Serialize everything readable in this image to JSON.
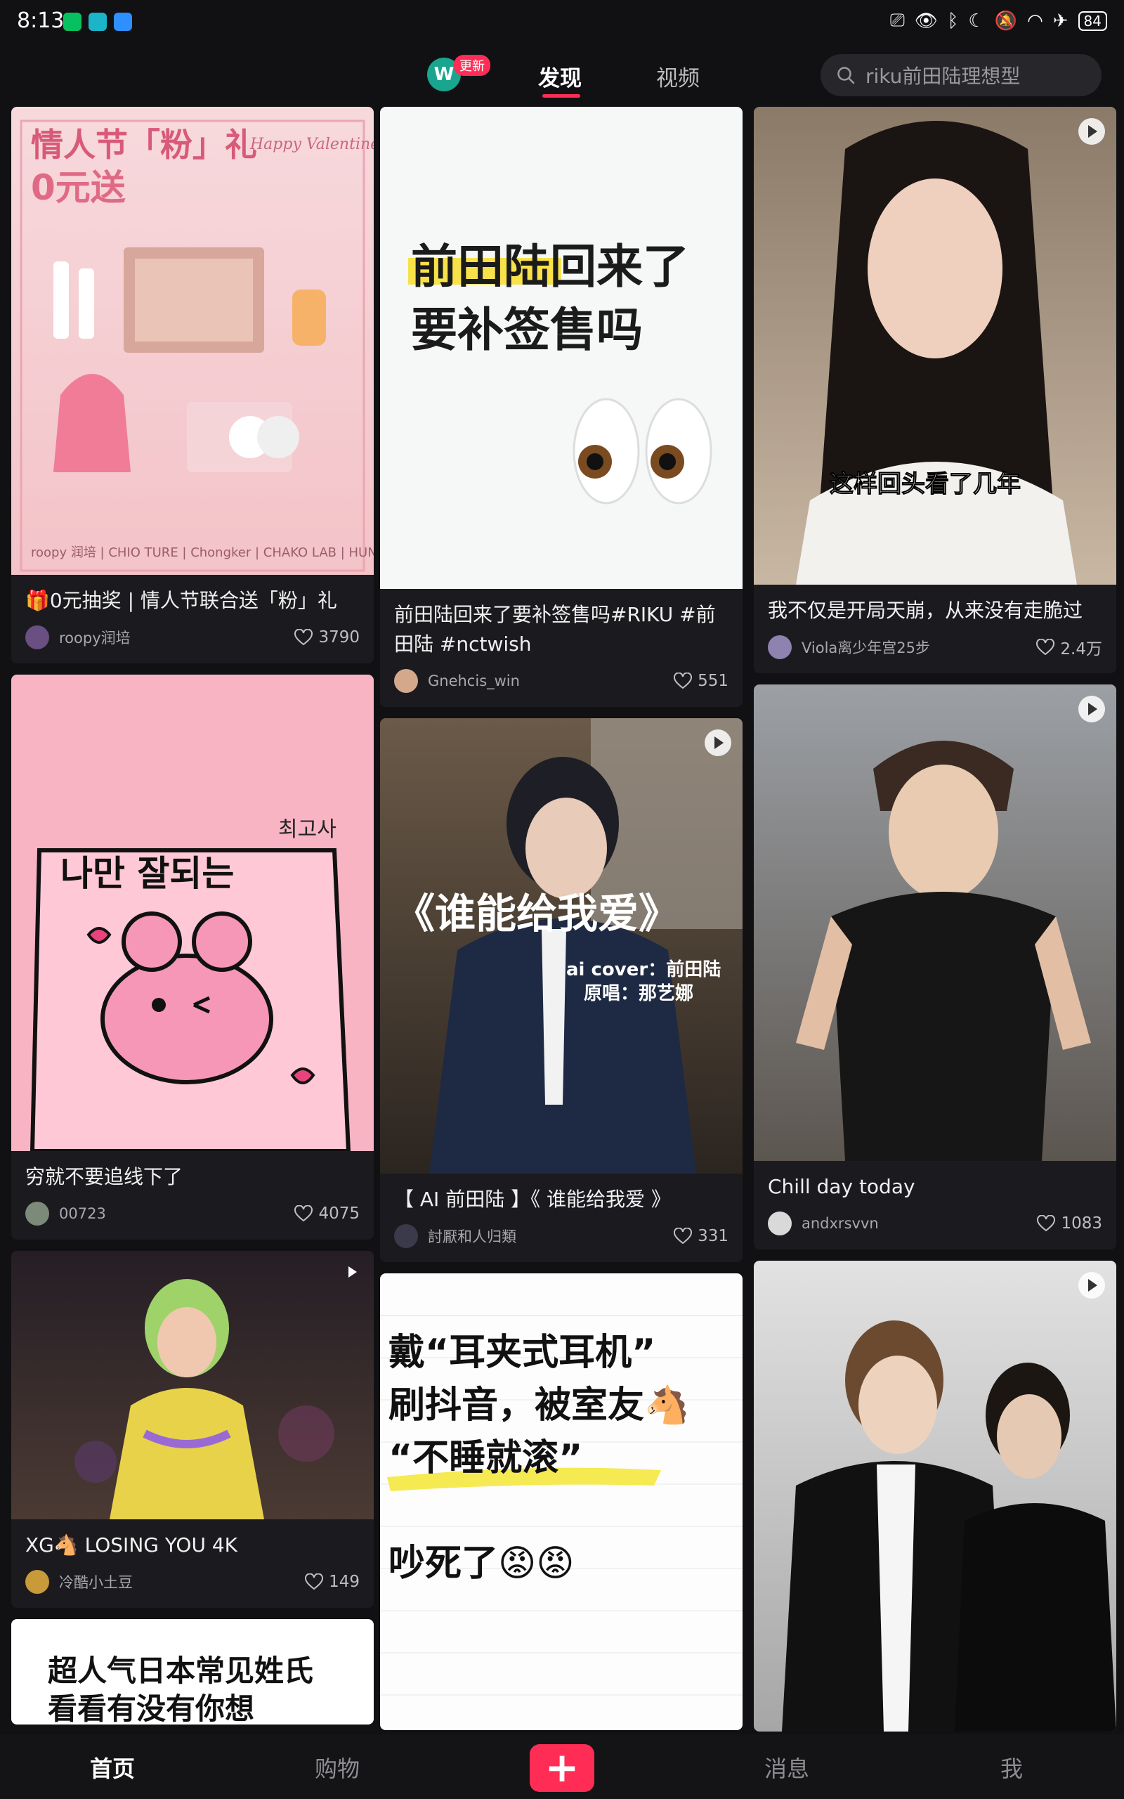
{
  "status_bar": {
    "time": "8:13",
    "battery": "84"
  },
  "top_nav": {
    "logo": "W",
    "update_badge": "更新",
    "tabs": [
      {
        "label": "发现",
        "active": true
      },
      {
        "label": "视频",
        "active": false
      }
    ],
    "search_placeholder": "riku前田陆理想型"
  },
  "covers": {
    "valentine": {
      "headline_1": "情人节「粉」礼",
      "headline_2": "0元送",
      "headline_en": "Happy Valentine's Day",
      "brands": "roopy 润培 | CHIO TURE | Chongker | CHAKO LAB | HUNG CHI"
    },
    "riku": {
      "line_1": "前田陆回来了",
      "line_2": "要补签售吗"
    },
    "woman": {
      "subtitle": "这样回头看了几年"
    },
    "pink": {
      "korean_top": "최고사",
      "korean_main": "나만 잘되는"
    },
    "ai": {
      "title": "《谁能给我爱》",
      "credit_1": "ai cover：前田陆",
      "credit_2": "原唱：那艺娜"
    },
    "ear": {
      "line_1": "戴“耳夹式耳机”",
      "line_2": "刷抖音，被室友🐴",
      "line_3": "“不睡就滚”",
      "line_4": "吵死了😡😡"
    },
    "name": {
      "line_1": "超人气日本常见姓氏",
      "line_2": "看看有没有你想"
    }
  },
  "feed": {
    "col1": [
      {
        "id": "valentine",
        "title": "🎁0元抽奖 | 情人节联合送「粉」礼",
        "author": "roopy润培",
        "likes": "3790",
        "video": false
      },
      {
        "id": "pink",
        "title": "穷就不要追线下了",
        "author": "00723",
        "likes": "4075",
        "video": false
      },
      {
        "id": "xg",
        "title": "XG🐴 LOSING YOU 4K",
        "author": "冷酷小土豆",
        "likes": "149",
        "video": true
      }
    ],
    "col2": [
      {
        "id": "riku",
        "title": "前田陆回来了要补签售吗#RIKU #前田陆 #nctwish",
        "author": "Gnehcis_win",
        "likes": "551",
        "video": false
      },
      {
        "id": "ai",
        "title": "【 AI 前田陆 】《 谁能给我爱 》",
        "author": "討厭和人归類",
        "likes": "331",
        "video": true
      }
    ],
    "col3": [
      {
        "id": "woman",
        "title": "我不仅是开局天崩，从来没有走脆过",
        "author": "Viola离少年宫25步",
        "likes": "2.4万",
        "video": true
      },
      {
        "id": "chill",
        "title": "Chill day today",
        "author": "andxrsvvn",
        "likes": "1083",
        "video": true
      }
    ]
  },
  "bottom_nav": {
    "home": "首页",
    "shop": "购物",
    "add": "+",
    "messages": "消息",
    "me": "我"
  },
  "colors": {
    "accent": "#ff2d55",
    "background": "#111114",
    "card": "#1b1b1f"
  }
}
